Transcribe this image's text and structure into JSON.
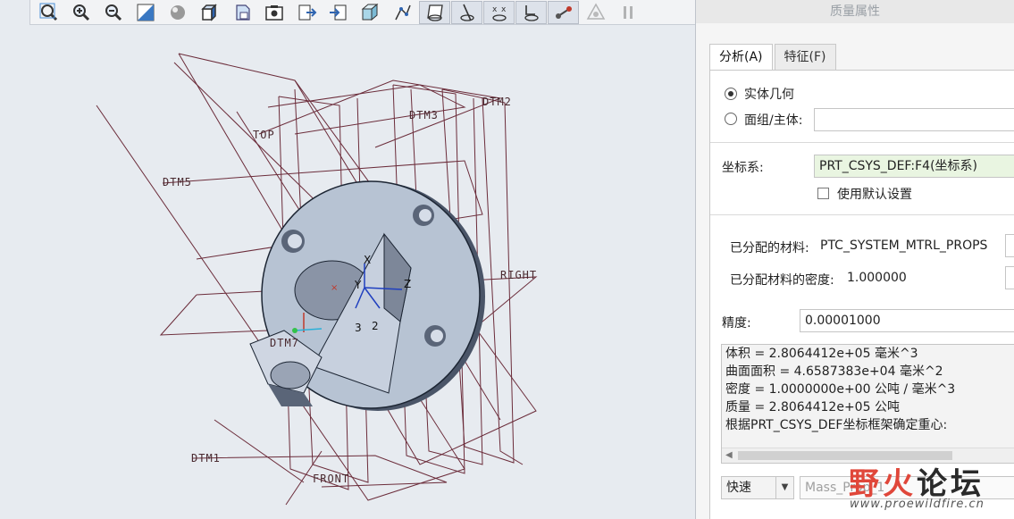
{
  "toolbar": {
    "icons": [
      "zoom-fit-icon",
      "zoom-in-icon",
      "zoom-out-icon",
      "repaint-icon",
      "display-style-icon",
      "saved-views-icon",
      "view-manager-icon",
      "perspective-icon",
      "datum-display-icon",
      "reorient-icon",
      "section-icon",
      "point-display-icon",
      "datum-planes-icon",
      "datum-axes-icon",
      "datum-points-icon",
      "csys-display-icon",
      "annotation-icon",
      "spin-center-icon",
      "pause-icon"
    ]
  },
  "viewport": {
    "datum_labels": {
      "top": "TOP",
      "dtm3": "DTM3",
      "dtm2": "DTM2",
      "dtm5": "DTM5",
      "right": "RIGHT",
      "dtm7": "DTM7",
      "dtm1": "DTM1",
      "front": "FRONT"
    },
    "axis_labels": {
      "x": "X",
      "y": "Y",
      "z": "Z",
      "n3": "3",
      "n2": "2"
    }
  },
  "dialog": {
    "title": "质量属性",
    "tabs": {
      "analysis": "分析(A)",
      "feature": "特征(F)"
    },
    "geometry": {
      "solid": "实体几何",
      "quilt": "面组/主体:",
      "quilt_value": "",
      "selected": "solid"
    },
    "csys": {
      "label": "坐标系:",
      "value": "PRT_CSYS_DEF:F4(坐标系)",
      "use_default_label": "使用默认设置",
      "use_default": false
    },
    "material": {
      "assigned_label": "已分配的材料:",
      "assigned_value": "PTC_SYSTEM_MTRL_PROPS",
      "density_label": "已分配材料的密度:",
      "density_value": "1.000000"
    },
    "precision": {
      "label": "精度:",
      "value": "0.00001000"
    },
    "results": [
      "体积 =  2.8064412e+05  毫米^3",
      "曲面面积 =  4.6587383e+04  毫米^2",
      "密度 =  1.0000000e+00 公吨 / 毫米^3",
      "质量 =  2.8064412e+05 公吨",
      "根据PRT_CSYS_DEF坐标框架确定重心:"
    ],
    "mode": {
      "value": "快速",
      "name_placeholder": "Mass_Prop_1"
    }
  },
  "watermark": {
    "cn_red": "野火",
    "cn_dark": "论坛",
    "url": "www.proewildfire.cn"
  },
  "colors": {
    "datum": "#6b2c3a",
    "part_face": "#b7c3d3",
    "part_dark": "#4a5568",
    "panel_accent": "#e9f5e1"
  }
}
